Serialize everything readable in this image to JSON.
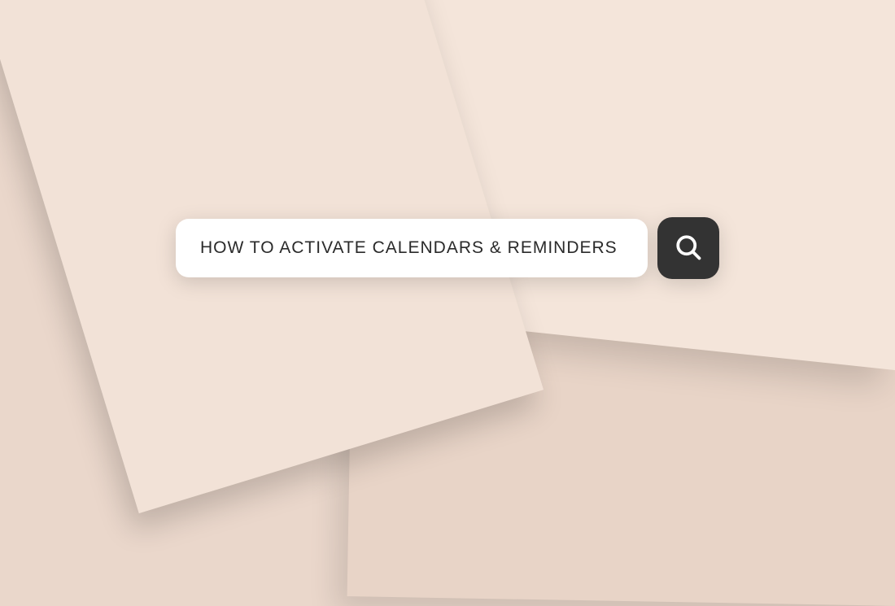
{
  "search": {
    "query": "HOW TO ACTIVATE CALENDARS & REMINDERS"
  },
  "colors": {
    "background": "#ead7cb",
    "paper_light": "#f2e2d7",
    "button_bg": "#333333",
    "icon_color": "#ffffff"
  }
}
